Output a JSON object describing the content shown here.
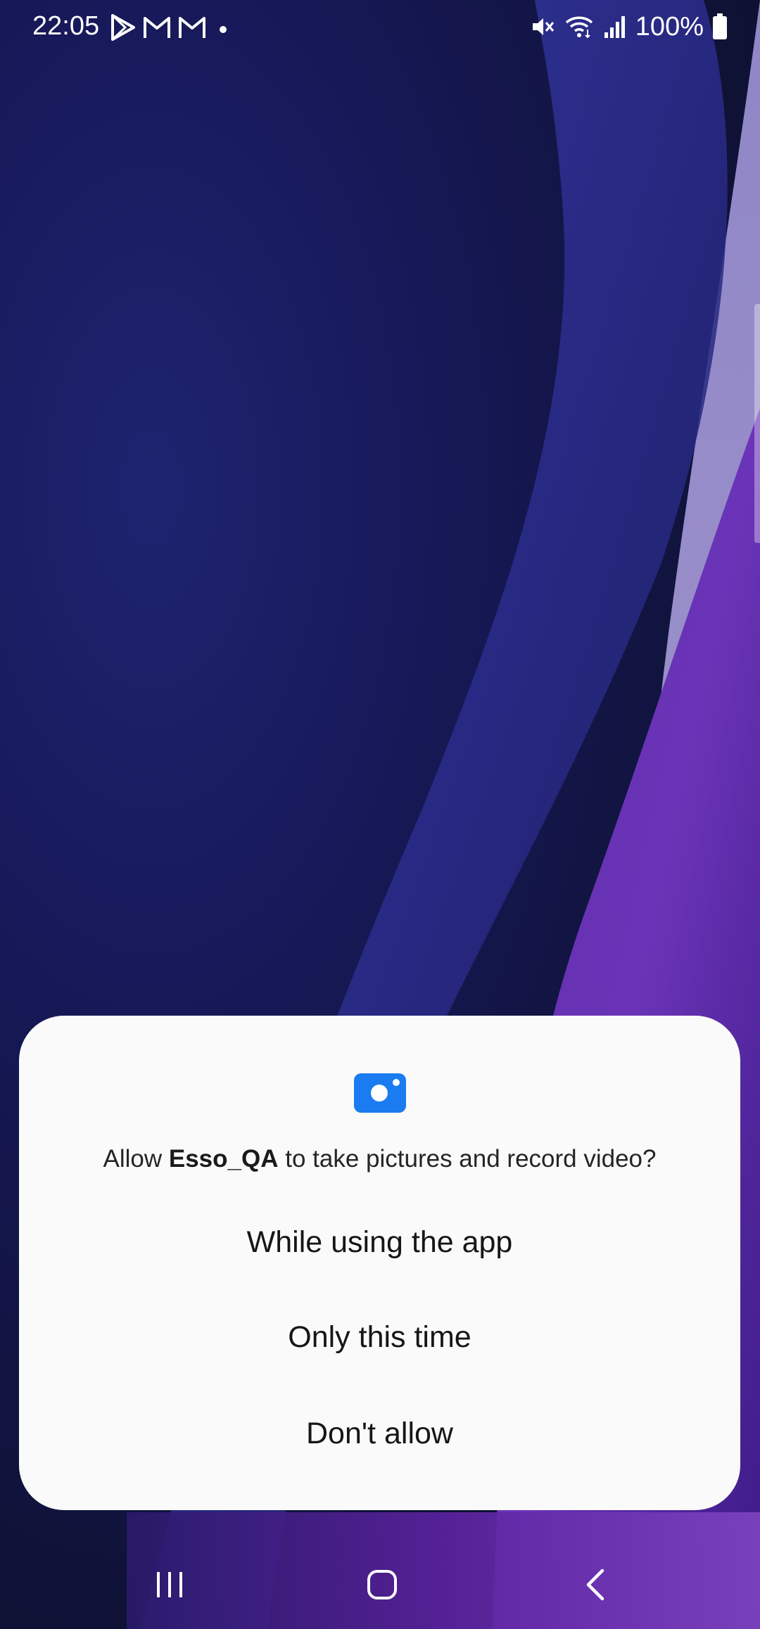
{
  "status_bar": {
    "time": "22:05",
    "battery": "100%",
    "left_icons": [
      "play-store-icon",
      "gmail-icon",
      "gmail-icon",
      "dot-icon"
    ],
    "right_icons": [
      "mute-icon",
      "wifi-icon",
      "signal-icon",
      "battery-icon"
    ]
  },
  "dialog": {
    "icon": "camera-icon",
    "icon_color": "#1a7cf0",
    "message_prefix": "Allow ",
    "app_name": "Esso_QA",
    "message_suffix": " to take pictures and record video?",
    "options": [
      "While using the app",
      "Only this time",
      "Don't allow"
    ]
  },
  "nav_bar": {
    "buttons": [
      "recents-icon",
      "home-icon",
      "back-icon"
    ]
  }
}
